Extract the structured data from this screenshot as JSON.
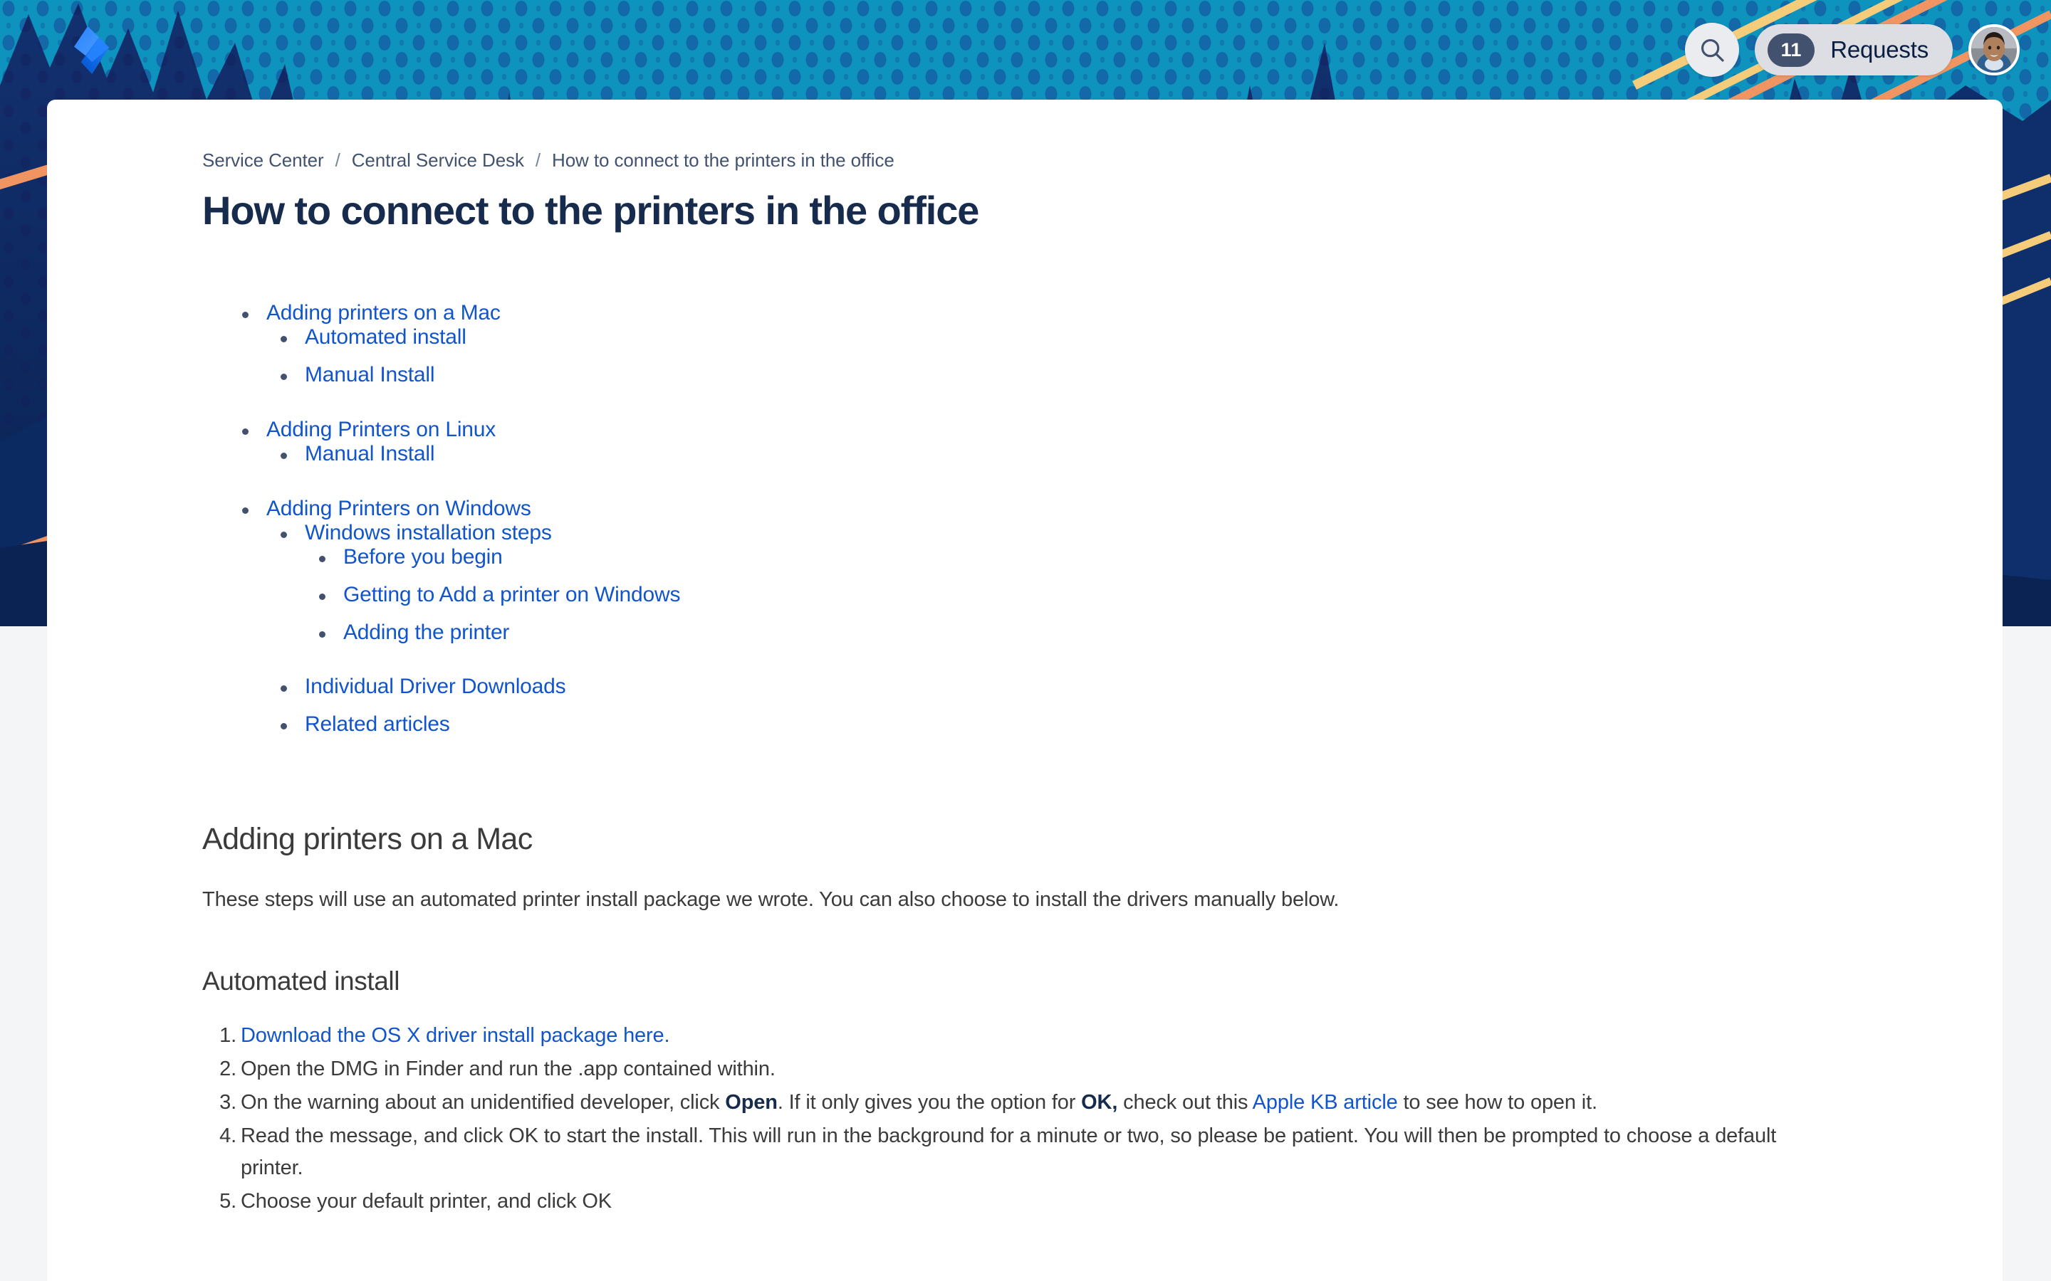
{
  "header": {
    "logo_name": "jira-service-management-logo",
    "search_label": "Search",
    "requests_count": "11",
    "requests_label": "Requests",
    "avatar_label": "User avatar"
  },
  "breadcrumb": {
    "items": [
      {
        "label": "Service Center"
      },
      {
        "label": "Central Service Desk"
      },
      {
        "label": "How to connect to the printers in the office"
      }
    ],
    "separator": "/"
  },
  "article": {
    "title": "How to connect to the printers in the office"
  },
  "toc": [
    {
      "label": "Adding printers on a Mac",
      "children": [
        {
          "label": "Automated install"
        },
        {
          "label": "Manual Install"
        }
      ]
    },
    {
      "label": "Adding Printers on Linux",
      "children": [
        {
          "label": "Manual Install"
        }
      ]
    },
    {
      "label": "Adding Printers on Windows",
      "children": [
        {
          "label": "Windows installation steps",
          "children": [
            {
              "label": "Before you begin"
            },
            {
              "label": "Getting to Add a printer on Windows"
            },
            {
              "label": "Adding the printer"
            }
          ]
        },
        {
          "label": "Individual Driver Downloads"
        },
        {
          "label": "Related articles"
        }
      ]
    }
  ],
  "sections": {
    "mac_heading": "Adding printers on a Mac",
    "mac_intro": "These steps will use an automated printer install package we wrote. You can also choose to install the drivers manually below.",
    "automated_heading": "Automated install",
    "steps": [
      {
        "parts": [
          {
            "type": "link",
            "text": "Download the OS X driver install package here."
          }
        ]
      },
      {
        "parts": [
          {
            "type": "text",
            "text": "Open the DMG in Finder and run the .app contained within."
          }
        ]
      },
      {
        "parts": [
          {
            "type": "text",
            "text": "On the warning about an unidentified developer, click "
          },
          {
            "type": "bold",
            "text": "Open"
          },
          {
            "type": "text",
            "text": ". If it only gives you the option for "
          },
          {
            "type": "bold",
            "text": "OK,"
          },
          {
            "type": "text",
            "text": " check out this "
          },
          {
            "type": "link",
            "text": "Apple KB article"
          },
          {
            "type": "text",
            "text": " to see how to open it."
          }
        ]
      },
      {
        "parts": [
          {
            "type": "text",
            "text": "Read the message, and click OK to start the install. This will run in the background for a minute or two, so please be patient. You will then be prompted to choose a default printer."
          }
        ]
      },
      {
        "parts": [
          {
            "type": "text",
            "text": "Choose your default printer, and click OK"
          }
        ]
      }
    ]
  },
  "colors": {
    "banner_cyan": "#0d93bd",
    "banner_navy": "#0b2a64",
    "banner_navy_dark": "#0a2352",
    "banner_accent_gold": "#f5cd7a",
    "banner_accent_orange": "#f09562",
    "link_blue": "#1155cc",
    "title_navy": "#172b4d",
    "body_gray": "#3b3b3b",
    "page_bg": "#f4f5f7",
    "logo_blue": "#2684ff",
    "logo_blue_light": "#4c9aff"
  }
}
